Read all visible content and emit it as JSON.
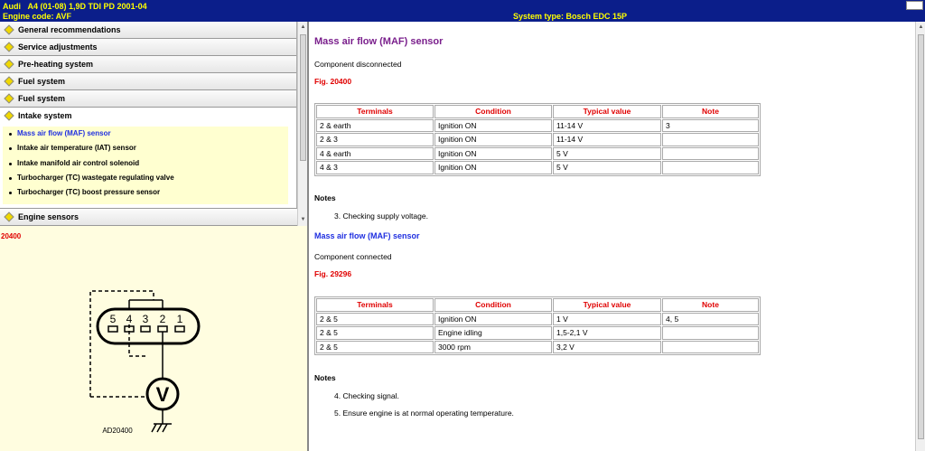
{
  "titlebar": {
    "make": "Audi",
    "model": "A4 (01-08) 1,9D TDI PD 2001-04",
    "engine_code": "Engine code: AVF",
    "system_type": "System type: Bosch EDC 15P"
  },
  "menu": {
    "items": [
      {
        "label": "General recommendations"
      },
      {
        "label": "Service adjustments"
      },
      {
        "label": "Pre-heating system"
      },
      {
        "label": "Fuel system"
      },
      {
        "label": "Fuel system"
      },
      {
        "label": "Intake system"
      }
    ],
    "subitems": [
      {
        "label": "Mass air flow (MAF) sensor"
      },
      {
        "label": "Intake air temperature (IAT) sensor"
      },
      {
        "label": "Intake manifold air control solenoid"
      },
      {
        "label": "Turbocharger (TC) wastegate regulating valve"
      },
      {
        "label": "Turbocharger (TC) boost pressure sensor"
      }
    ],
    "last_item": "Engine sensors"
  },
  "left_figure": {
    "label": "20400",
    "diagram_code": "AD20400",
    "pins": [
      "5",
      "4",
      "3",
      "2",
      "1"
    ],
    "meter_symbol": "V"
  },
  "content": {
    "title": "Mass air flow (MAF) sensor",
    "section1": {
      "state": "Component disconnected",
      "fig": "Fig. 20400",
      "headers": [
        "Terminals",
        "Condition",
        "Typical value",
        "Note"
      ],
      "rows": [
        [
          "2 & earth",
          "Ignition ON",
          "11-14 V",
          "3"
        ],
        [
          "2 & 3",
          "Ignition ON",
          "11-14 V",
          ""
        ],
        [
          "4 & earth",
          "Ignition ON",
          "5 V",
          ""
        ],
        [
          "4 & 3",
          "Ignition ON",
          "5 V",
          ""
        ]
      ],
      "notes_heading": "Notes",
      "notes": [
        "3. Checking supply voltage."
      ]
    },
    "subtitle": "Mass air flow (MAF) sensor",
    "section2": {
      "state": "Component connected",
      "fig": "Fig. 29296",
      "headers": [
        "Terminals",
        "Condition",
        "Typical value",
        "Note"
      ],
      "rows": [
        [
          "2 & 5",
          "Ignition ON",
          "1 V",
          "4, 5"
        ],
        [
          "2 & 5",
          "Engine idling",
          "1,5-2,1 V",
          ""
        ],
        [
          "2 & 5",
          "3000 rpm",
          "3,2 V",
          ""
        ]
      ],
      "notes_heading": "Notes",
      "notes": [
        "4. Checking signal.",
        "5. Ensure engine is at normal operating temperature."
      ]
    }
  },
  "colors": {
    "titlebar_bg": "#0b1e8a",
    "titlebar_text": "#ffff00",
    "heading": "#7a1f8c",
    "subheading": "#1f2fe0",
    "accent_red": "#e00000",
    "left_panel_bg": "#fffde0"
  }
}
